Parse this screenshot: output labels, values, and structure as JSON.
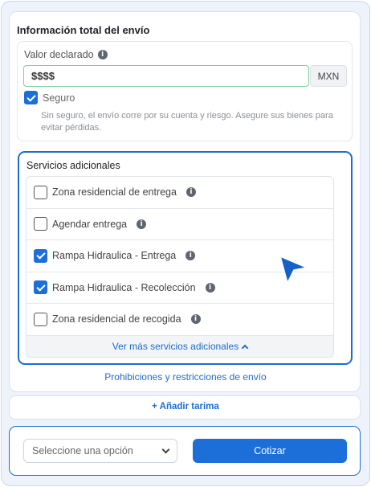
{
  "shipment": {
    "title": "Información total del envío",
    "declared_label": "Valor declarado",
    "declared_value": "$$$$",
    "currency": "MXN",
    "insurance_label": "Seguro",
    "insurance_checked": true,
    "insurance_note": "Sin seguro, el envío corre por su cuenta y riesgo. Asegure sus bienes para evitar pérdidas."
  },
  "services": {
    "title": "Servicios adicionales",
    "items": [
      {
        "label": "Zona residencial de entrega",
        "checked": false
      },
      {
        "label": "Agendar entrega",
        "checked": false
      },
      {
        "label": "Rampa Hidraulica - Entrega",
        "checked": true
      },
      {
        "label": "Rampa Hidraulica - Recolección",
        "checked": true
      },
      {
        "label": "Zona residencial de recogida",
        "checked": false
      }
    ],
    "more_label": "Ver más servicios adicionales"
  },
  "links": {
    "prohibitions": "Prohibiciones y restricciones de envío",
    "add_pallet": "Añadir tarima"
  },
  "footer": {
    "select_placeholder": "Seleccione una opción",
    "quote_label": "Cotizar"
  },
  "colors": {
    "accent": "#1c6fd8",
    "input_border": "#7ecfa3"
  }
}
